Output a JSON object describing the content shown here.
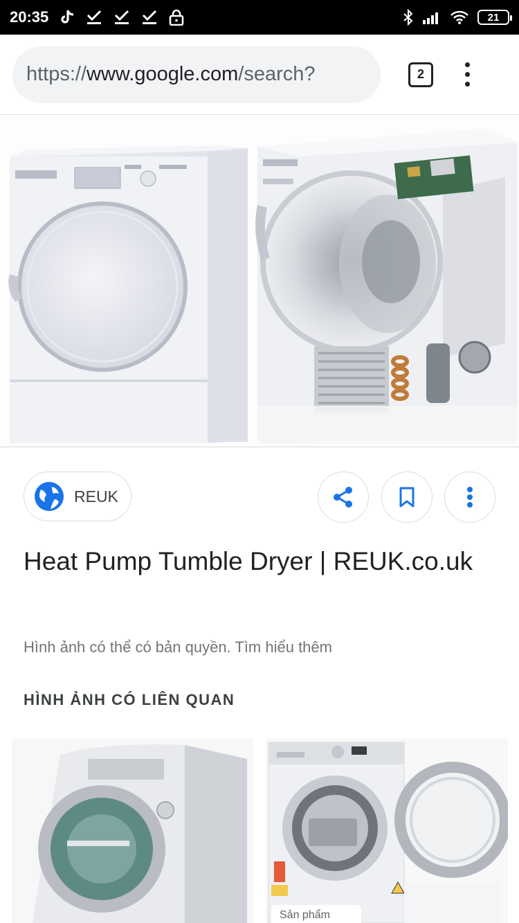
{
  "status_bar": {
    "time": "20:35",
    "battery": "21"
  },
  "browser": {
    "url_scheme": "https://",
    "url_host": "www.google.com",
    "url_path": "/search?",
    "tab_count": "2"
  },
  "result": {
    "source_name": "REUK",
    "title": "Heat Pump Tumble Dryer | REUK.co.uk",
    "copyright_note": "Hình ảnh có thể có bản quyền. Tìm hiểu thêm",
    "related_heading": "HÌNH ẢNH CÓ LIÊN QUAN"
  },
  "related_images": [
    {
      "caption": ""
    },
    {
      "caption": "Sản phẩm"
    }
  ],
  "icons": {
    "share": "share-icon",
    "bookmark": "bookmark-icon",
    "more": "more-vert-icon",
    "globe": "globe-icon"
  },
  "colors": {
    "accent_blue": "#1a73e8",
    "status_bar": "#000000",
    "url_box": "#f1f3f4"
  }
}
